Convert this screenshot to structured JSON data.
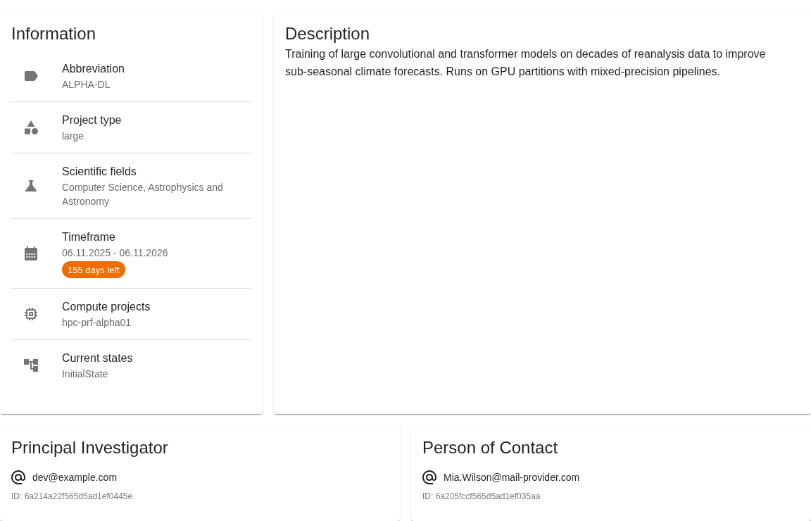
{
  "information": {
    "title": "Information",
    "items": [
      {
        "kind": "abbreviation",
        "label": "Abbreviation",
        "value": "ALPHA-DL"
      },
      {
        "kind": "project_type",
        "label": "Project type",
        "value": "large"
      },
      {
        "kind": "scientific_fields",
        "label": "Scientific fields",
        "value": "Computer Science, Astrophysics and Astronomy"
      },
      {
        "kind": "timeframe",
        "label": "Timeframe",
        "value": "06.11.2025 - 06.11.2026",
        "badge": "155 days left"
      },
      {
        "kind": "compute_projects",
        "label": "Compute projects",
        "value": "hpc-prf-alpha01"
      },
      {
        "kind": "states",
        "label": "Current states",
        "value": "InitialState"
      }
    ]
  },
  "description": {
    "title": "Description",
    "text": "Training of large convolutional and transformer models on decades of reanalysis data to improve sub-seasonal climate forecasts. Runs on GPU partitions with mixed-precision pipelines."
  },
  "contacts": [
    {
      "title": "Principal Investigator",
      "email": "dev@example.com",
      "id": "ID: 6a214a22f565d5ad1ef0445e"
    },
    {
      "title": "Person of Contact",
      "email": "Mia.Wilson@mail-provider.com",
      "id": "ID: 6a205fccf565d5ad1ef035aa"
    }
  ]
}
